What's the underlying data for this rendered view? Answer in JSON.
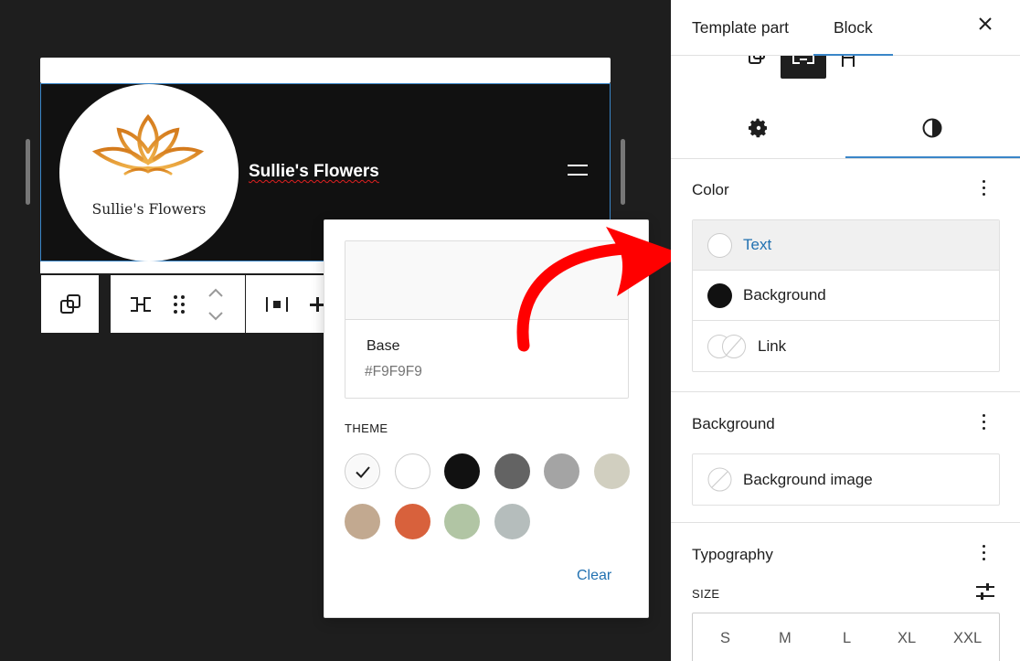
{
  "canvas": {
    "site_title": "Sullie's Flowers",
    "logo_text": "Sullie's Flowers"
  },
  "popover": {
    "selected_name": "Base",
    "selected_hex": "#F9F9F9",
    "theme_label": "THEME",
    "clear_label": "Clear",
    "theme_colors": [
      "#f9f9f9",
      "#ffffff",
      "#111111",
      "#636363",
      "#a4a4a4",
      "#d1cfc0",
      "#c2a990",
      "#d8613c",
      "#b1c5a4",
      "#b5bdbc"
    ]
  },
  "sidebar": {
    "tabs": [
      "Template part",
      "Block"
    ],
    "active_tab": "Block",
    "color_panel": {
      "title": "Color",
      "items": [
        {
          "label": "Text",
          "selected": true
        },
        {
          "label": "Background",
          "selected": false
        },
        {
          "label": "Link",
          "selected": false
        }
      ]
    },
    "background_panel": {
      "title": "Background",
      "item": "Background image"
    },
    "typography_panel": {
      "title": "Typography",
      "size_label": "SIZE",
      "sizes": [
        "S",
        "M",
        "L",
        "XL",
        "XXL"
      ]
    }
  },
  "colors": {
    "accent": "#3a86c8",
    "link": "#2271b1",
    "annotation_arrow": "#ff0000"
  }
}
